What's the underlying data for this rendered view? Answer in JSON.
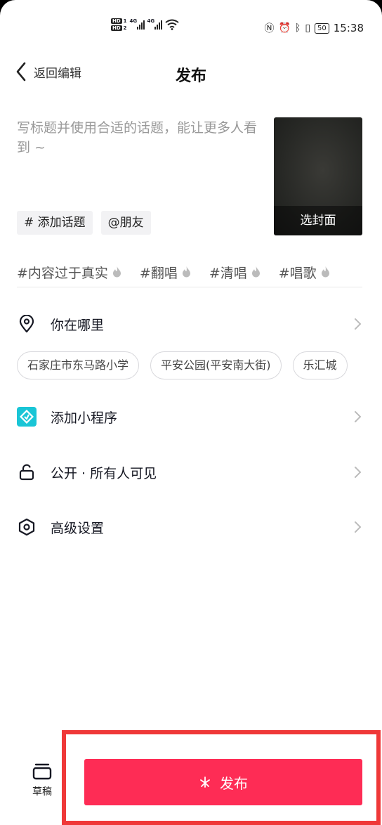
{
  "status_bar": {
    "sim1": "1",
    "sim2": "2",
    "net1": "4G",
    "net2": "4G",
    "battery": "50",
    "time": "15:38"
  },
  "nav": {
    "back_label": "返回编辑",
    "title": "发布"
  },
  "caption": {
    "placeholder": "写标题并使用合适的话题，能让更多人看到 ~"
  },
  "chips": {
    "add_topic": "# 添加话题",
    "mention": "@朋友"
  },
  "cover": {
    "label": "选封面"
  },
  "topics": [
    "#内容过于真实",
    "#翻唱",
    "#清唱",
    "#唱歌"
  ],
  "location": {
    "label": "你在哪里",
    "suggestions": [
      "石家庄市东马路小学",
      "平安公园(平安南大街)",
      "乐汇城"
    ]
  },
  "rows": {
    "mini_program": "添加小程序",
    "visibility": "公开 · 所有人可见",
    "advanced": "高级设置"
  },
  "bottom": {
    "draft_label": "草稿",
    "publish_label": "发布"
  },
  "colors": {
    "publish": "#fe2c55",
    "highlight_frame": "#ef3838",
    "mini_program_icon": "#19c5d6",
    "flame": "#bbbbbb"
  }
}
